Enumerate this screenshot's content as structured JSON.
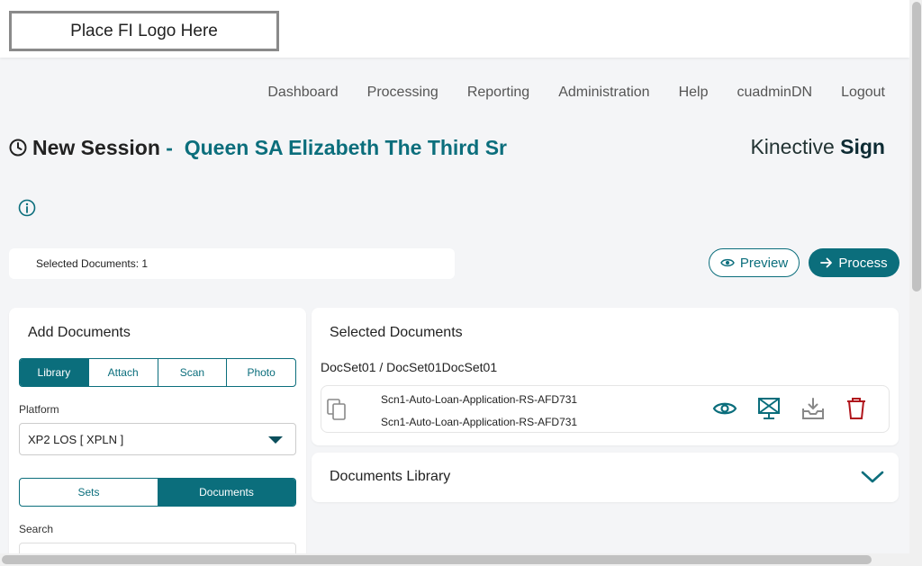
{
  "header": {
    "logo_text": "Place FI Logo Here"
  },
  "nav": {
    "items": [
      "Dashboard",
      "Processing",
      "Reporting",
      "Administration",
      "Help",
      "cuadminDN",
      "Logout"
    ]
  },
  "session": {
    "title": "New Session",
    "separator": "-",
    "customer_name": "Queen SA Elizabeth The Third Sr"
  },
  "brand": {
    "light": "Kinective",
    "bold": "Sign"
  },
  "toolbar": {
    "selected_count": "Selected Documents: 1",
    "preview_label": "Preview",
    "process_label": "Process"
  },
  "add_documents": {
    "title": "Add Documents",
    "source_tabs": [
      "Library",
      "Attach",
      "Scan",
      "Photo"
    ],
    "active_source": "Library",
    "platform_label": "Platform",
    "platform_value": "XP2 LOS [ XPLN ]",
    "mode_tabs": [
      "Sets",
      "Documents"
    ],
    "active_mode": "Documents",
    "search_label": "Search"
  },
  "selected_documents": {
    "title": "Selected Documents",
    "docset_path": "DocSet01 / DocSet01DocSet01",
    "rows": [
      {
        "line1": "Scn1-Auto-Loan-Application-RS-AFD731",
        "line2": "Scn1-Auto-Loan-Application-RS-AFD731"
      }
    ]
  },
  "documents_library": {
    "title": "Documents Library"
  },
  "colors": {
    "accent": "#0b6e7c",
    "danger": "#b0151c"
  }
}
